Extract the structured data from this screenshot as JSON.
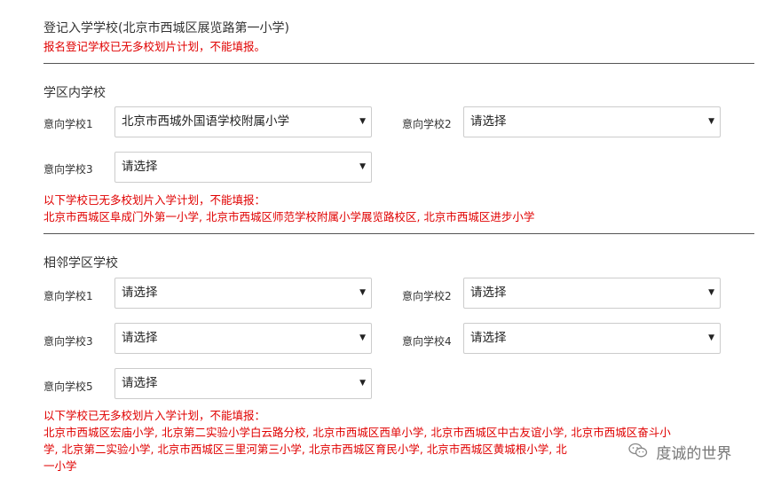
{
  "registered_school": {
    "title": "登记入学学校(北京市西城区展览路第一小学)",
    "notice": "报名登记学校已无多校划片计划，不能填报。"
  },
  "district_schools": {
    "heading": "学区内学校",
    "choices": [
      {
        "label": "意向学校1",
        "value": "北京市西城外国语学校附属小学"
      },
      {
        "label": "意向学校2",
        "value": "请选择"
      },
      {
        "label": "意向学校3",
        "value": "请选择"
      }
    ],
    "notice_title": "以下学校已无多校划片入学计划，不能填报：",
    "notice_list": "北京市西城区阜成门外第一小学, 北京市西城区师范学校附属小学展览路校区, 北京市西城区进步小学"
  },
  "neighbor_schools": {
    "heading": "相邻学区学校",
    "choices": [
      {
        "label": "意向学校1",
        "value": "请选择"
      },
      {
        "label": "意向学校2",
        "value": "请选择"
      },
      {
        "label": "意向学校3",
        "value": "请选择"
      },
      {
        "label": "意向学校4",
        "value": "请选择"
      },
      {
        "label": "意向学校5",
        "value": "请选择"
      }
    ],
    "notice_title": "以下学校已无多校划片入学计划，不能填报：",
    "notice_line1": "北京市西城区宏庙小学, 北京第二实验小学白云路分校, 北京市西城区西单小学, 北京市西城区中古友谊小学, 北京市西城区奋斗小",
    "notice_line2": "学, 北京第二实验小学, 北京市西城区三里河第三小学, 北京市西城区育民小学, 北京市西城区黄城根小学, 北",
    "notice_line3": "一小学"
  },
  "watermark": {
    "text": "度诚的世界",
    "icon": "wechat-icon"
  },
  "colors": {
    "alert": "#e00000",
    "divider": "#555555",
    "select_border": "#cccccc"
  }
}
